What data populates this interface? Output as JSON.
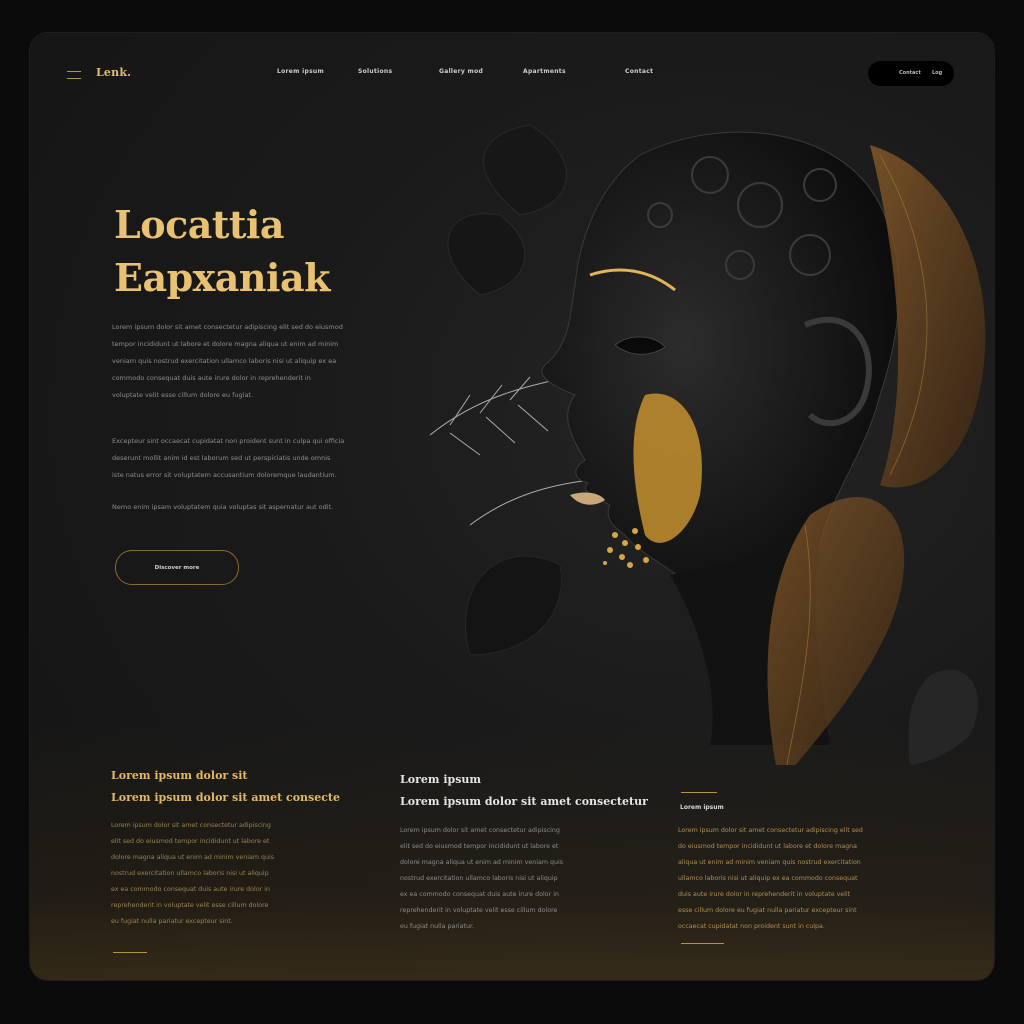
{
  "header": {
    "logo": "Lenk.",
    "nav": [
      "Lorem ipsum",
      "Solutions",
      "Gallery mod",
      "Apartments",
      "Contact"
    ],
    "pill": [
      "Contact",
      "Log"
    ]
  },
  "hero": {
    "title_line1": "Locattia",
    "title_line2": "Eapxaniak",
    "para1": "Lorem ipsum dolor sit amet consectetur adipiscing elit sed do eiusmod\ntempor incididunt ut labore et dolore magna aliqua ut enim ad minim\nveniam quis nostrud exercitation ullamco laboris nisi ut aliquip ex ea\ncommodo consequat duis aute irure dolor in reprehenderit in\nvoluptate velit esse cillum dolore eu fugiat.",
    "para2": "Excepteur sint occaecat cupidatat non proident sunt in culpa qui officia\ndeserunt mollit anim id est laborum sed ut perspiciatis unde omnis\niste natus error sit voluptatem accusantium doloremque laudantium.",
    "para3": "Nemo enim ipsam voluptatem quia voluptas sit aspernatur aut odit.",
    "cta_label": "Discover more"
  },
  "columns": [
    {
      "kicker": "Lorem ipsum dolor sit",
      "title": "Lorem ipsum dolor sit amet consecte",
      "body": "Lorem ipsum dolor sit amet consectetur adipiscing\nelit sed do eiusmod tempor incididunt ut labore et\ndolore magna aliqua ut enim ad minim veniam quis\nnostrud exercitation ullamco laboris nisi ut aliquip\nex ea commodo consequat duis aute irure dolor in\nreprehenderit in voluptate velit esse cillum dolore\neu fugiat nulla pariatur excepteur sint."
    },
    {
      "kicker": "Lorem ipsum",
      "title": "Lorem ipsum dolor sit amet consectetur",
      "body": "Lorem ipsum dolor sit amet consectetur adipiscing\nelit sed do eiusmod tempor incididunt ut labore et\ndolore magna aliqua ut enim ad minim veniam quis\nnostrud exercitation ullamco laboris nisi ut aliquip\nex ea commodo consequat duis aute irure dolor in\nreprehenderit in voluptate velit esse cillum dolore\neu fugiat nulla pariatur."
    },
    {
      "kicker": "Lorem ipsum",
      "body": "Lorem ipsum dolor sit amet consectetur adipiscing elit sed\ndo eiusmod tempor incididunt ut labore et dolore magna\naliqua ut enim ad minim veniam quis nostrud exercitation\nullamco laboris nisi ut aliquip ex ea commodo consequat\nduis aute irure dolor in reprehenderit in voluptate velit\nesse cillum dolore eu fugiat nulla pariatur excepteur sint\noccaecat cupidatat non proident sunt in culpa."
    }
  ],
  "colors": {
    "gold": "#e8c272",
    "gold_dark": "#b8923f",
    "background": "#1a1a1a"
  },
  "icons": [
    "menu-icon"
  ]
}
